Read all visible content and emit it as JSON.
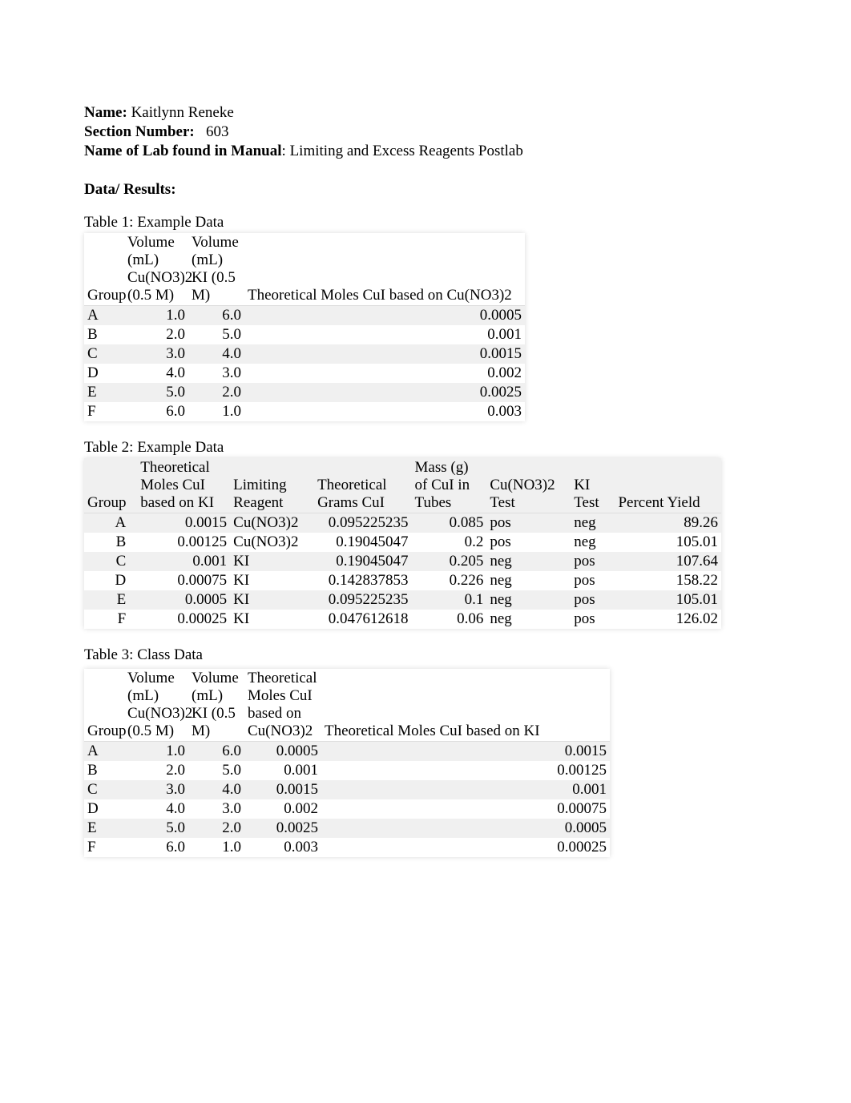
{
  "header": {
    "name_label": "Name:",
    "name_value": "Kaitlynn Reneke",
    "section_label": "Section Number:",
    "section_value": "603",
    "lab_label": "Name of Lab found in Manual",
    "lab_value": "Limiting and Excess Reagents Postlab"
  },
  "data_results_title": "Data/ Results:",
  "table1": {
    "caption": "Table 1: Example Data",
    "headers": {
      "group": "Group",
      "vol_cu": "Volume (mL) Cu(NO3)2  (0.5 M)",
      "vol_ki": "Volume (mL) KI (0.5 M)",
      "theor": "Theoretical Moles CuI based on Cu(NO3)2"
    },
    "rows": [
      {
        "g": "A",
        "v1": "1.0",
        "v2": "6.0",
        "t": "0.0005"
      },
      {
        "g": "B",
        "v1": "2.0",
        "v2": "5.0",
        "t": "0.001"
      },
      {
        "g": "C",
        "v1": "3.0",
        "v2": "4.0",
        "t": "0.0015"
      },
      {
        "g": "D",
        "v1": "4.0",
        "v2": "3.0",
        "t": "0.002"
      },
      {
        "g": "E",
        "v1": "5.0",
        "v2": "2.0",
        "t": "0.0025"
      },
      {
        "g": "F",
        "v1": "6.0",
        "v2": "1.0",
        "t": "0.003"
      }
    ]
  },
  "table2": {
    "caption": "Table 2: Example Data",
    "headers": {
      "group": "Group",
      "moles": "Theoretical Moles CuI based on KI",
      "lim": "Limiting Reagent",
      "grams": "Theoretical Grams CuI",
      "mass": "Mass (g) of CuI in Tubes",
      "cutest": "Cu(NO3)2 Test",
      "kitest": "KI Test",
      "yield": "Percent Yield"
    },
    "rows": [
      {
        "g": "A",
        "m": "0.0015",
        "lr": "Cu(NO3)2",
        "gr": "0.095225235",
        "ms": "0.085",
        "cu": "pos",
        "ki": "neg",
        "y": "89.26"
      },
      {
        "g": "B",
        "m": "0.00125",
        "lr": "Cu(NO3)2",
        "gr": "0.19045047",
        "ms": "0.2",
        "cu": "pos",
        "ki": "neg",
        "y": "105.01"
      },
      {
        "g": "C",
        "m": "0.001",
        "lr": "KI",
        "gr": "0.19045047",
        "ms": "0.205",
        "cu": "neg",
        "ki": "pos",
        "y": "107.64"
      },
      {
        "g": "D",
        "m": "0.00075",
        "lr": "KI",
        "gr": "0.142837853",
        "ms": "0.226",
        "cu": "neg",
        "ki": "pos",
        "y": "158.22"
      },
      {
        "g": "E",
        "m": "0.0005",
        "lr": "KI",
        "gr": "0.095225235",
        "ms": "0.1",
        "cu": "neg",
        "ki": "pos",
        "y": "105.01"
      },
      {
        "g": "F",
        "m": "0.00025",
        "lr": "KI",
        "gr": "0.047612618",
        "ms": "0.06",
        "cu": "neg",
        "ki": "pos",
        "y": "126.02"
      }
    ]
  },
  "table3": {
    "caption": "Table 3: Class Data",
    "headers": {
      "group": "Group",
      "vol_cu": "Volume (mL) Cu(NO3)2  (0.5 M)",
      "vol_ki": "Volume (mL) KI (0.5 M)",
      "theor_cu": "Theoretical Moles CuI based on Cu(NO3)2",
      "theor_ki": "Theoretical Moles CuI based on KI"
    },
    "rows": [
      {
        "g": "A",
        "v1": "1.0",
        "v2": "6.0",
        "tc": "0.0005",
        "tk": "0.0015"
      },
      {
        "g": "B",
        "v1": "2.0",
        "v2": "5.0",
        "tc": "0.001",
        "tk": "0.00125"
      },
      {
        "g": "C",
        "v1": "3.0",
        "v2": "4.0",
        "tc": "0.0015",
        "tk": "0.001"
      },
      {
        "g": "D",
        "v1": "4.0",
        "v2": "3.0",
        "tc": "0.002",
        "tk": "0.00075"
      },
      {
        "g": "E",
        "v1": "5.0",
        "v2": "2.0",
        "tc": "0.0025",
        "tk": "0.0005"
      },
      {
        "g": "F",
        "v1": "6.0",
        "v2": "1.0",
        "tc": "0.003",
        "tk": "0.00025"
      }
    ]
  }
}
